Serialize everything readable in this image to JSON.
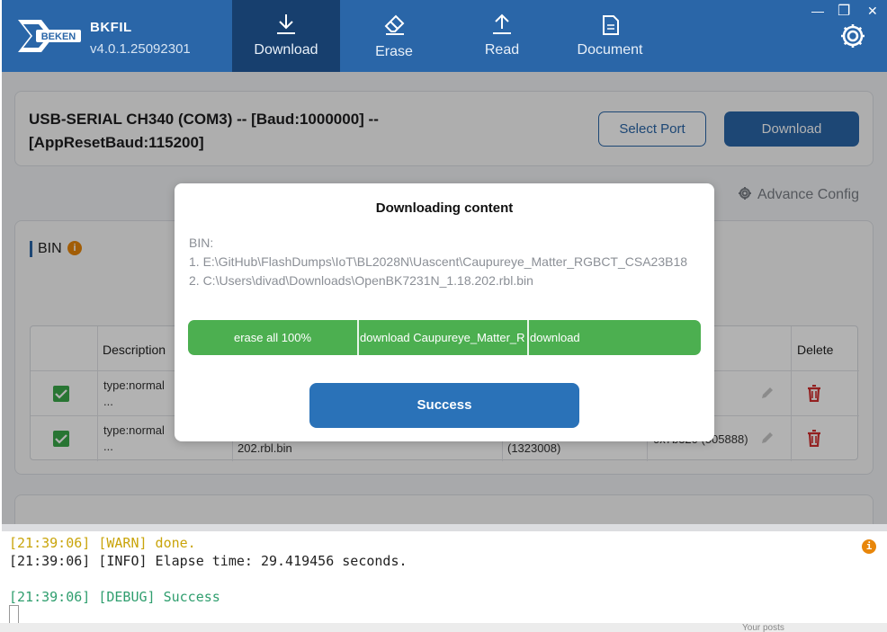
{
  "app": {
    "brand": "BKFIL",
    "version": "v4.0.1.25092301",
    "logo_text": "BEKEN"
  },
  "nav": {
    "tabs": [
      {
        "label": "Download",
        "icon": "download-icon",
        "active": true
      },
      {
        "label": "Erase",
        "icon": "eraser-icon",
        "active": false
      },
      {
        "label": "Read",
        "icon": "upload-icon",
        "active": false
      },
      {
        "label": "Document",
        "icon": "document-icon",
        "active": false
      }
    ]
  },
  "window": {
    "minimize": "—",
    "maximize": "❐",
    "close": "✕"
  },
  "port": {
    "line1": "USB-SERIAL CH340 (COM3) -- [Baud:1000000] --",
    "line2": "[AppResetBaud:115200]",
    "select_port_label": "Select Port",
    "download_label": "Download"
  },
  "advance_config": "Advance Config",
  "bin_section": {
    "title": "BIN",
    "columns": [
      "Description",
      "Delete"
    ],
    "rows": [
      {
        "checked": true,
        "description": "type:normal\n...",
        "file": "",
        "size": "",
        "address": ""
      },
      {
        "checked": true,
        "description": "type:normal\n...",
        "file": "202.rbl.bin",
        "size": "(1323008)",
        "address": "0x7b320 (505888)"
      }
    ]
  },
  "modal": {
    "title": "Downloading content",
    "bin_label": "BIN:",
    "files": [
      "1. E:\\GitHub\\FlashDumps\\IoT\\BL2028N\\Uascent\\Caupureye_Matter_RGBCT_CSA23B18",
      "2. C:\\Users\\divad\\Downloads\\OpenBK7231N_1.18.202.rbl.bin"
    ],
    "progress_segments": [
      "erase all 100%",
      "download Caupureye_Matter_R",
      "download"
    ],
    "success_label": "Success"
  },
  "console": {
    "lines": [
      {
        "level": "warn",
        "text": "[21:39:06] [WARN] done."
      },
      {
        "level": "info",
        "text": "[21:39:06] [INFO] Elapse time: 29.419456 seconds."
      },
      {
        "level": "debug",
        "text": "[21:39:06] [DEBUG] Success"
      }
    ]
  },
  "colors": {
    "header": "#2a66a8",
    "active_tab": "#173f6e",
    "progress": "#4caf50",
    "success_button": "#2a72b8",
    "warning": "#e8860a",
    "delete": "#d32f2f"
  },
  "background_fragments": {
    "posts": "Your posts"
  }
}
